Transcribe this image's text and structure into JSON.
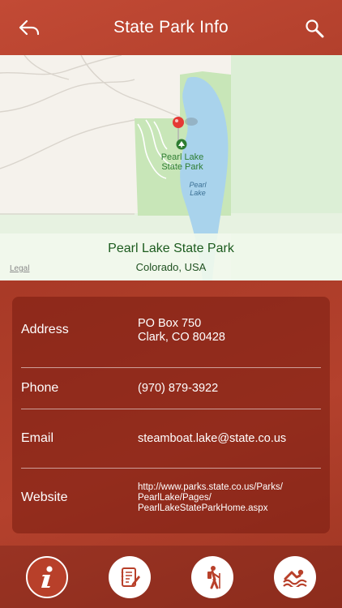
{
  "header": {
    "title": "State Park Info",
    "back_icon": "back-arrow-icon",
    "search_icon": "search-icon"
  },
  "map": {
    "park_label_line1": "Pearl Lake",
    "park_label_line2": "State Park",
    "lake_label_line1": "Pearl",
    "lake_label_line2": "Lake",
    "card_title": "Pearl Lake State Park",
    "card_location": "Colorado, USA",
    "legal": "Legal"
  },
  "details": {
    "address_label": "Address",
    "address_line1": "PO Box 750",
    "address_line2": "Clark, CO 80428",
    "phone_label": "Phone",
    "phone_value": "(970) 879-3922",
    "email_label": "Email",
    "email_value": "steamboat.lake@state.co.us",
    "website_label": "Website",
    "website_line1": "http://www.parks.state.co.us/Parks/",
    "website_line2": "PearlLake/Pages/",
    "website_line3": "PearlLakeStateParkHome.aspx"
  },
  "tabs": [
    {
      "icon": "info-icon",
      "active": true
    },
    {
      "icon": "notes-icon",
      "active": false
    },
    {
      "icon": "hiking-icon",
      "active": false
    },
    {
      "icon": "swimming-icon",
      "active": false
    }
  ],
  "colors": {
    "accent": "#b8402a",
    "park_green": "#2e7d32",
    "lake_blue": "#a9d3ec"
  }
}
